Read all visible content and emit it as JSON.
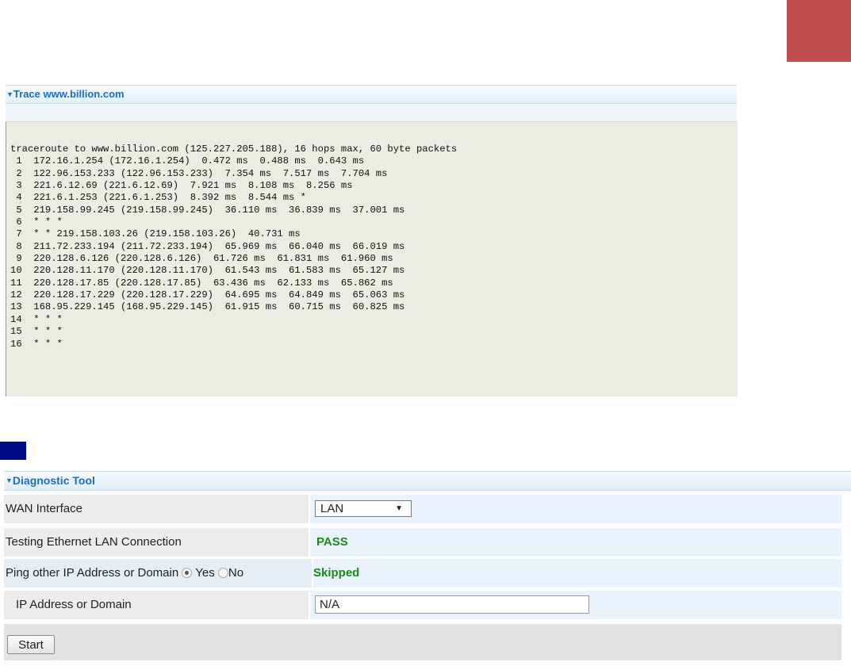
{
  "colors": {
    "accent_blue": "#1d6fb8",
    "pass_green": "#1a8a1a",
    "red_block": "#c0504d",
    "navy_block": "#000c8a"
  },
  "trace": {
    "title": "Trace www.billion.com",
    "output": "traceroute to www.billion.com (125.227.205.188), 16 hops max, 60 byte packets\n 1  172.16.1.254 (172.16.1.254)  0.472 ms  0.488 ms  0.643 ms\n 2  122.96.153.233 (122.96.153.233)  7.354 ms  7.517 ms  7.704 ms\n 3  221.6.12.69 (221.6.12.69)  7.921 ms  8.108 ms  8.256 ms\n 4  221.6.1.253 (221.6.1.253)  8.392 ms  8.544 ms *\n 5  219.158.99.245 (219.158.99.245)  36.110 ms  36.839 ms  37.001 ms\n 6  * * *\n 7  * * 219.158.103.26 (219.158.103.26)  40.731 ms\n 8  211.72.233.194 (211.72.233.194)  65.969 ms  66.040 ms  66.019 ms\n 9  220.128.6.126 (220.128.6.126)  61.726 ms  61.831 ms  61.960 ms\n10  220.128.11.170 (220.128.11.170)  61.543 ms  61.583 ms  65.127 ms\n11  220.128.17.85 (220.128.17.85)  63.436 ms  62.133 ms  65.862 ms\n12  220.128.17.229 (220.128.17.229)  64.695 ms  64.849 ms  65.063 ms\n13  168.95.229.145 (168.95.229.145)  61.915 ms  60.715 ms  60.825 ms\n14  * * *\n15  * * *\n16  * * *"
  },
  "diagnostic": {
    "title": "Diagnostic Tool",
    "wan_label": "WAN Interface",
    "wan_value": "LAN",
    "lan_test_label": "Testing Ethernet LAN Connection",
    "lan_test_result": "PASS",
    "ping_label": "Ping other IP Address or Domain",
    "ping_yes": "Yes",
    "ping_no": "No",
    "ping_selected": "Yes",
    "ping_result": "Skipped",
    "ip_label": "IP Address or Domain",
    "ip_value": "N/A",
    "start_label": "Start"
  }
}
